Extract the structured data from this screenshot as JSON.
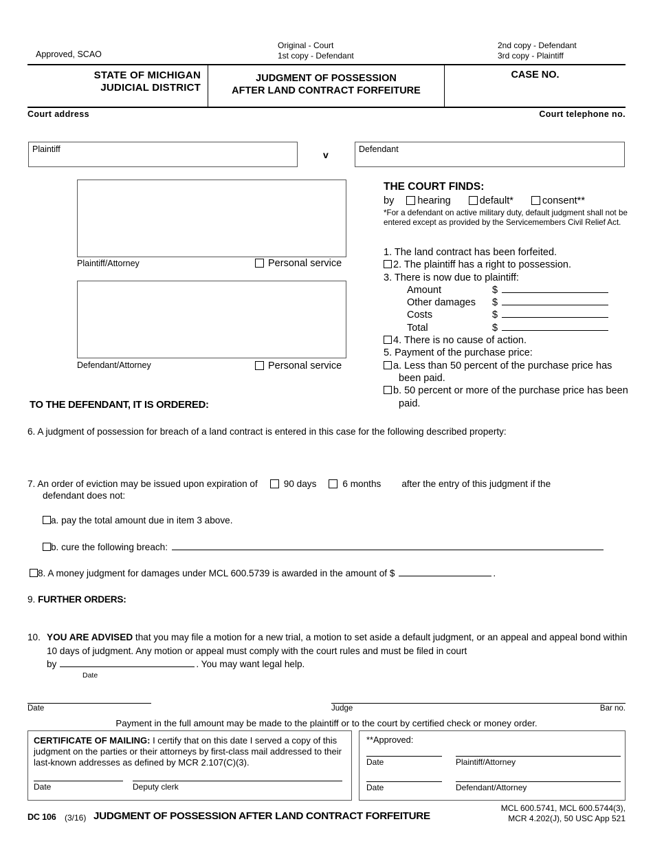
{
  "header": {
    "approved_scao": "Approved, SCAO",
    "copies_center": [
      "Original - Court",
      "1st copy  -  Defendant"
    ],
    "copies_right": [
      "2nd copy - Defendant",
      "3rd copy - Plaintiff"
    ],
    "state_line1": "STATE OF MICHIGAN",
    "state_line2": "JUDICIAL DISTRICT",
    "title_line1": "JUDGMENT OF POSSESSION",
    "title_line2": "AFTER LAND CONTRACT FORFEITURE",
    "case_no_label": "CASE NO.",
    "court_address_label": "Court  address",
    "court_telephone_label": "Court  telephone  no."
  },
  "parties": {
    "plaintiff_label": "Plaintiff",
    "v_label": "v",
    "defendant_label": "Defendant",
    "plaintiff_attorney_label": "Plaintiff/Attorney",
    "defendant_attorney_label": "Defendant/Attorney",
    "personal_service_label": "Personal service"
  },
  "court_finds": {
    "title": "THE COURT FINDS:",
    "by_label": "by",
    "options": [
      "hearing",
      "default*",
      "consent**"
    ],
    "note": "*For a defendant on active military duty, default judgment shall not be entered except as provided by the Servicemembers Civil Relief Act.",
    "item1": "1.  The land contract has been forfeited.",
    "item2": "2.  The plaintiff has a right to possession.",
    "item3": "3.  There is now due to plaintiff:",
    "money_rows": [
      {
        "label": "Amount",
        "currency": "$",
        "value": ""
      },
      {
        "label": "Other damages",
        "currency": "$",
        "value": ""
      },
      {
        "label": "Costs",
        "currency": "$",
        "value": ""
      },
      {
        "label": "Total",
        "currency": "$",
        "value": ""
      }
    ],
    "item4": "4.  There is no cause of action.",
    "item5": "5.  Payment of the purchase price:",
    "item5a": "a.  Less than 50 percent of the purchase price has been paid.",
    "item5b": "b.  50 percent or more of the purchase price has been paid."
  },
  "ordered": {
    "heading": "TO THE DEFENDANT, IT IS ORDERED:",
    "item6": "6.  A judgment of possession for breach of a land contract is entered in this case for the following described property:",
    "item7_prefix": "7.  An order of eviction may be issued upon expiration of",
    "item7_opt1": "90 days",
    "item7_opt2": "6 months",
    "item7_suffix": "after the entry of this judgment if the",
    "item7_sub": "defendant does not:",
    "item7a": "a.  pay the total amount due in item 3 above.",
    "item7b": "b.  cure the following breach:",
    "item8": "8.  A money judgment for damages under MCL 600.5739 is awarded in the amount of $",
    "item8_period": ".",
    "item9_num": "9.",
    "item9_heading": "FURTHER ORDERS:",
    "item10_num": "10.",
    "item10_bold": "YOU ARE ADVISED",
    "item10_text": " that you may file a motion for a new trial, a motion to set aside a default judgment, or an appeal and appeal bond within 10 days of judgment. Any motion or appeal must comply with the court rules and must be filed in court",
    "item10_by": "by",
    "item10_date_label": "Date",
    "item10_tail": ". You may want legal help."
  },
  "signature": {
    "date_label": "Date",
    "judge_label": "Judge",
    "bar_label": "Bar no.",
    "payment_note": "Payment in the full amount may be made to the plaintiff or to the court by certified check or money order."
  },
  "certificate": {
    "bold_label": "CERTIFICATE OF MAILING:",
    "body": " I certify that on this date I served a copy of this judgment on the parties or their attorneys by first-class mail addressed to their last-known addresses as defined by MCR 2.107(C)(3).",
    "date_label": "Date",
    "clerk_label": "Deputy clerk"
  },
  "approved": {
    "title": "**Approved:",
    "date1_label": "Date",
    "attorney1_label": "Plaintiff/Attorney",
    "date2_label": "Date",
    "attorney2_label": "Defendant/Attorney"
  },
  "footer": {
    "form_no": "DC 106",
    "revision": "(3/16)",
    "title": "JUDGMENT OF POSSESSION AFTER LAND CONTRACT FORFEITURE",
    "cite_line1": "MCL 600.5741, MCL 600.5744(3),",
    "cite_line2": "MCR 4.202(J), 50 USC App 521"
  }
}
